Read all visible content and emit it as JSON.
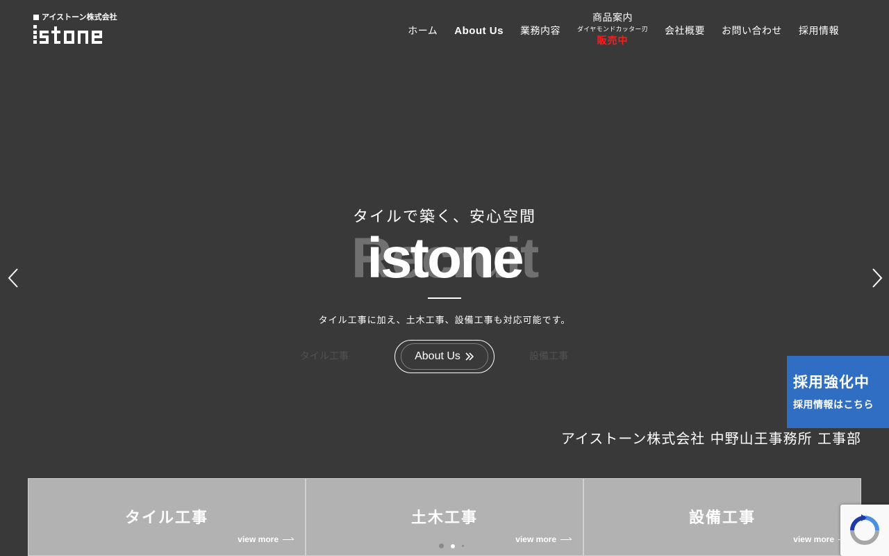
{
  "header": {
    "logo_sub": "アイストーン株式会社",
    "nav": [
      {
        "label": "ホーム"
      },
      {
        "label": "About Us"
      },
      {
        "label": "業務内容"
      },
      {
        "label": "会社概要"
      },
      {
        "label": "お問い合わせ"
      },
      {
        "label": "採用情報"
      }
    ],
    "products": {
      "line1": "商品案内",
      "line2": "ダイヤモンドカッター刃",
      "line3": "販売中"
    }
  },
  "hero": {
    "tagline": "タイルで築く、安心空間",
    "title": "istone",
    "ghost_title": "Recruit",
    "description": "タイル工事に加え、土木工事、設備工事も対応可能です。",
    "button_label": "About Us",
    "ghost_link_1": "タイル工事",
    "ghost_link_2": "設備工事"
  },
  "company_name": "アイストーン株式会社 中野山王事務所 工事部",
  "recruit_banner": {
    "line1": "採用強化中",
    "line2": "採用情報はこちら"
  },
  "services": [
    {
      "title": "タイル工事",
      "more": "view more"
    },
    {
      "title": "土木工事",
      "more": "view more"
    },
    {
      "title": "設備工事",
      "more": "view more"
    }
  ],
  "slider": {
    "current_slide": 2,
    "total_slides": 3
  },
  "colors": {
    "background": "#393939",
    "accent_red": "#ff1a1a",
    "recruit_blue": "#2f6ec2",
    "card_gray": "#b2b2b2"
  },
  "icons": {
    "prev": "chevron-left-icon",
    "next": "chevron-right-icon",
    "button_arrow": "double-chevron-right-icon",
    "recaptcha": "recaptcha-icon"
  }
}
